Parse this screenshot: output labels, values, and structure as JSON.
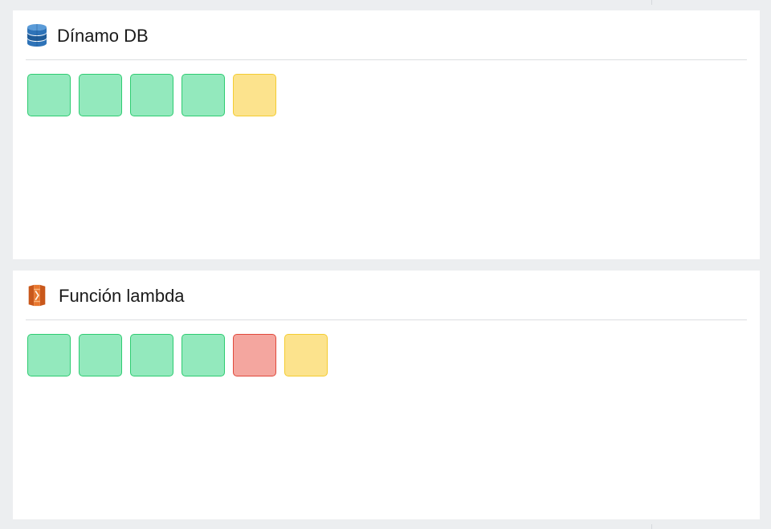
{
  "panels": [
    {
      "title": "Dínamo DB",
      "icon": "dynamodb-icon",
      "icon_color": "#2e73b8",
      "statuses": [
        "ok",
        "ok",
        "ok",
        "ok",
        "warn"
      ]
    },
    {
      "title": "Función lambda",
      "icon": "lambda-icon",
      "icon_color": "#e8772e",
      "statuses": [
        "ok",
        "ok",
        "ok",
        "ok",
        "fail",
        "warn"
      ]
    }
  ],
  "status_colors": {
    "ok": "#93e9bd",
    "warn": "#fce38d",
    "fail": "#f4a69f"
  }
}
